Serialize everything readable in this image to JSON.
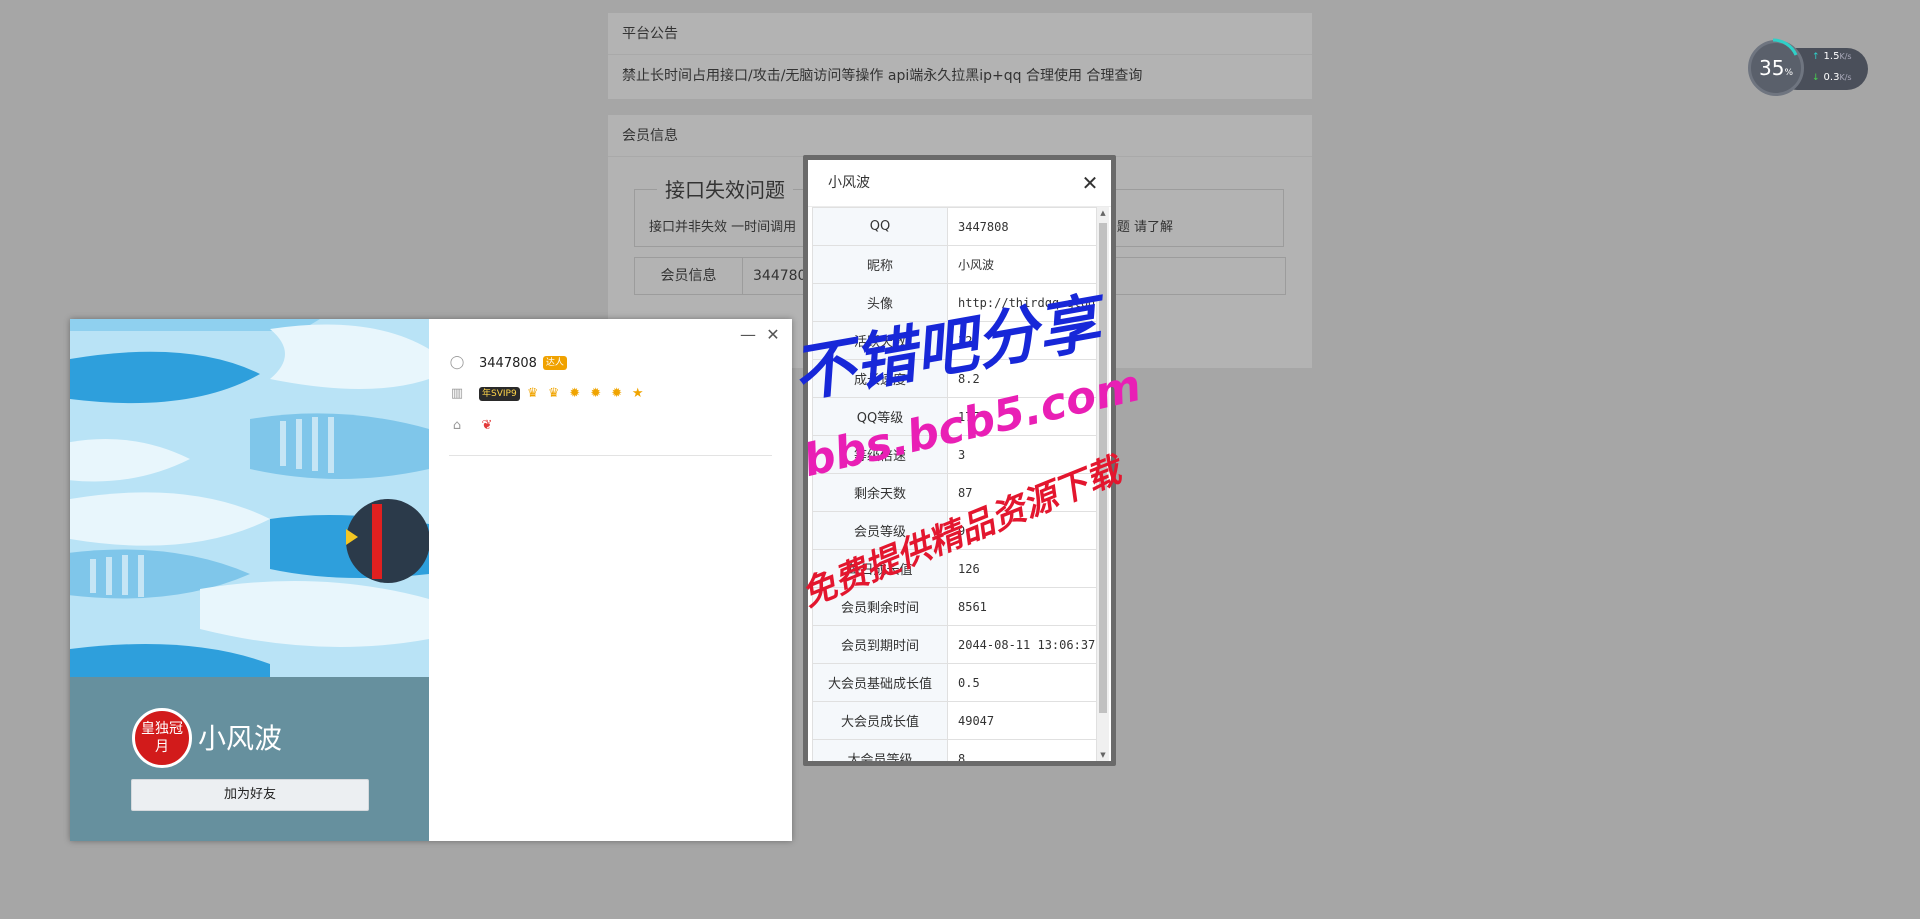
{
  "notice": {
    "title": "平台公告",
    "text": "禁止长时间占用接口/攻击/无脑访问等操作 api端永久拉黑ip+qq 合理使用 合理查询"
  },
  "member": {
    "title": "会员信息",
    "issue_legend": "接口失效问题",
    "issue_text": "接口并非失效 一时间调用",
    "issue_tail": "题 请了解",
    "row_label": "会员信息",
    "row_value": "3447808"
  },
  "speed": {
    "percent": "35",
    "percent_unit": "%",
    "up": "1.5",
    "down": "0.3",
    "unit": "K/s",
    "accent": "#2fd0c8"
  },
  "qq_card": {
    "qq": "3447808",
    "talent_badge": "达人",
    "svip_badge": "年SVIP9",
    "nickname": "小风波",
    "avatar_text": "皇独冠月",
    "add_friend": "加为好友",
    "minimize": "—",
    "close": "✕"
  },
  "modal": {
    "title": "小风波",
    "close": "✕",
    "rows": [
      {
        "k": "QQ",
        "v": "3447808"
      },
      {
        "k": "昵称",
        "v": "小风波"
      },
      {
        "k": "头像",
        "v": "http://thirdqq.qlogo."
      },
      {
        "k": "活跃天数",
        "v": "32"
      },
      {
        "k": "成长速度",
        "v": "8.2"
      },
      {
        "k": "QQ等级",
        "v": "177"
      },
      {
        "k": "等级倍速",
        "v": "3"
      },
      {
        "k": "剩余天数",
        "v": "87"
      },
      {
        "k": "会员等级",
        "v": "9"
      },
      {
        "k": "每日成长值",
        "v": "126"
      },
      {
        "k": "会员剩余时间",
        "v": "8561"
      },
      {
        "k": "会员到期时间",
        "v": "2044-08-11 13:06:37"
      },
      {
        "k": "大会员基础成长值",
        "v": "0.5"
      },
      {
        "k": "大会员成长值",
        "v": "49047"
      },
      {
        "k": "大会员等级",
        "v": "8"
      }
    ]
  },
  "watermark": {
    "line1": "不错吧分享",
    "line2": "bbs.bcb5.com",
    "line3": "免费提供精品资源下载"
  }
}
